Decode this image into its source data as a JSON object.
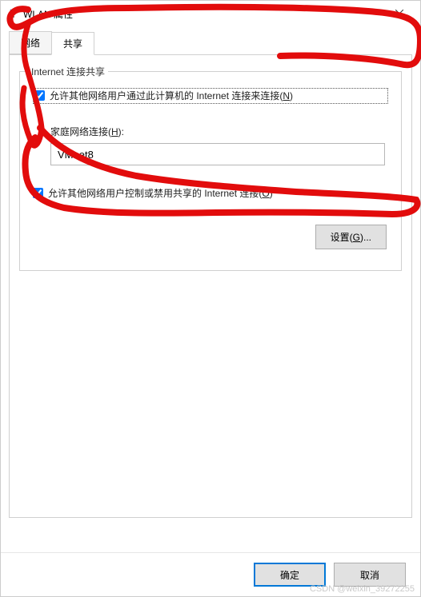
{
  "window": {
    "title": "WLAN 属性"
  },
  "tabs": {
    "network": "网络",
    "sharing": "共享"
  },
  "group": {
    "title": "Internet 连接共享"
  },
  "checkbox1": {
    "label": "允许其他网络用户通过此计算机的 Internet 连接来连接(N)"
  },
  "home_conn": {
    "label": "家庭网络连接(H):",
    "value": "VMnet8"
  },
  "checkbox2": {
    "label": "允许其他网络用户控制或禁用共享的 Internet 连接(O)"
  },
  "buttons": {
    "settings": "设置(G)...",
    "ok": "确定",
    "cancel": "取消"
  },
  "watermark": "CSDN @weixin_39272255"
}
